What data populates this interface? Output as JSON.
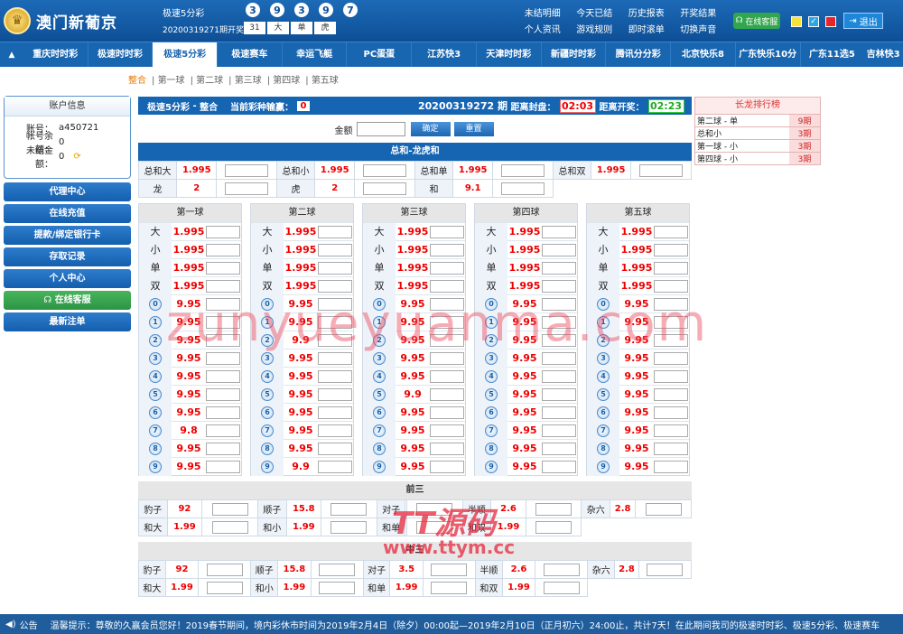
{
  "brand": "澳门新葡京",
  "header": {
    "game": "极速5分彩",
    "draw_label": "20200319271期开奖",
    "balls": [
      "3",
      "9",
      "3",
      "9",
      "7"
    ],
    "sum": [
      "31",
      "大",
      "单",
      "虎"
    ]
  },
  "toplinks": {
    "row1": [
      "未结明细",
      "今天已结",
      "历史报表",
      "开奖结果"
    ],
    "row2": [
      "个人资讯",
      "游戏规则",
      "即时滚单",
      "切换声音"
    ]
  },
  "service_btn": "在线客服",
  "logout": "退出",
  "colors": {
    "nav": "#1865b0",
    "odds": "#e00",
    "green": "#31a64c"
  },
  "nav": [
    "重庆时时彩",
    "极速时时彩",
    "极速5分彩",
    "极速赛车",
    "幸运飞艇",
    "PC蛋蛋",
    "江苏快3",
    "天津时时彩",
    "新疆时时彩",
    "腾讯分分彩",
    "北京快乐8",
    "广东快乐10分",
    "广东11选5",
    "吉林快3"
  ],
  "subnav": [
    "整合",
    "第一球",
    "第二球",
    "第三球",
    "第四球",
    "第五球"
  ],
  "account": {
    "title": "账户信息",
    "rows": [
      [
        "账号：",
        "a450721"
      ],
      [
        "帐号余额：",
        "0"
      ],
      [
        "未结金额：",
        "0"
      ]
    ]
  },
  "side_buttons": [
    "代理中心",
    "在线充值",
    "提款/绑定银行卡",
    "存取记录",
    "个人中心",
    "在线客服",
    "最新注单"
  ],
  "bar": {
    "game": "极速5分彩",
    "mode": "整合",
    "unsettled_label": "当前彩种输赢：",
    "unsettled": "0",
    "draw": "20200319272 期",
    "close_label": "距离封盘：",
    "close": "02:03",
    "open_label": "距离开奖：",
    "open": "02:23"
  },
  "amount": {
    "label": "金额",
    "ok": "确定",
    "reset": "重置"
  },
  "total": {
    "title": "总和-龙虎和",
    "row1": [
      [
        "总和大",
        "1.995"
      ],
      [
        "总和小",
        "1.995"
      ],
      [
        "总和单",
        "1.995"
      ],
      [
        "总和双",
        "1.995"
      ]
    ],
    "row2": [
      [
        "龙",
        "2"
      ],
      [
        "虎",
        "2"
      ],
      [
        "和",
        "9.1"
      ]
    ]
  },
  "balls": [
    {
      "title": "第一球",
      "big": "1.995",
      "small": "1.995",
      "odd": "1.995",
      "even": "1.995",
      "nums": [
        "9.95",
        "9.95",
        "9.95",
        "9.95",
        "9.95",
        "9.95",
        "9.95",
        "9.8",
        "9.95",
        "9.95"
      ]
    },
    {
      "title": "第二球",
      "big": "1.995",
      "small": "1.995",
      "odd": "1.995",
      "even": "1.995",
      "nums": [
        "9.95",
        "9.95",
        "9.9",
        "9.95",
        "9.95",
        "9.95",
        "9.95",
        "9.95",
        "9.95",
        "9.9"
      ]
    },
    {
      "title": "第三球",
      "big": "1.995",
      "small": "1.995",
      "odd": "1.995",
      "even": "1.995",
      "nums": [
        "9.95",
        "9.95",
        "9.95",
        "9.95",
        "9.95",
        "9.9",
        "9.95",
        "9.95",
        "9.95",
        "9.95"
      ]
    },
    {
      "title": "第四球",
      "big": "1.995",
      "small": "1.995",
      "odd": "1.995",
      "even": "1.995",
      "nums": [
        "9.95",
        "9.95",
        "9.95",
        "9.95",
        "9.95",
        "9.95",
        "9.95",
        "9.95",
        "9.95",
        "9.95"
      ]
    },
    {
      "title": "第五球",
      "big": "1.995",
      "small": "1.995",
      "odd": "1.995",
      "even": "1.995",
      "nums": [
        "9.95",
        "9.95",
        "9.95",
        "9.95",
        "9.95",
        "9.95",
        "9.95",
        "9.95",
        "9.95",
        "9.95"
      ]
    }
  ],
  "labels": {
    "big": "大",
    "small": "小",
    "odd": "单",
    "even": "双"
  },
  "front3": {
    "title": "前三",
    "row1": [
      [
        "豹子",
        "92"
      ],
      [
        "顺子",
        "15.8"
      ],
      [
        "对子",
        ""
      ],
      [
        "半顺",
        "2.6"
      ],
      [
        "杂六",
        "2.8"
      ]
    ],
    "row2": [
      [
        "和大",
        "1.99"
      ],
      [
        "和小",
        "1.99"
      ],
      [
        "和单",
        ""
      ],
      [
        "和双",
        "1.99"
      ]
    ]
  },
  "mid3": {
    "title": "中三",
    "row1": [
      [
        "豹子",
        "92"
      ],
      [
        "顺子",
        "15.8"
      ],
      [
        "对子",
        "3.5"
      ],
      [
        "半顺",
        "2.6"
      ],
      [
        "杂六",
        "2.8"
      ]
    ],
    "row2": [
      [
        "和大",
        "1.99"
      ],
      [
        "和小",
        "1.99"
      ],
      [
        "和单",
        "1.99"
      ],
      [
        "和双",
        "1.99"
      ]
    ]
  },
  "longdragon": {
    "title": "长龙排行榜",
    "rows": [
      [
        "第二球 - 单",
        "9期"
      ],
      [
        "总和小",
        "3期"
      ],
      [
        "第一球 - 小",
        "3期"
      ],
      [
        "第四球 - 小",
        "3期"
      ]
    ]
  },
  "notice": {
    "label": "公告",
    "text": "温馨提示：尊敬的久赢会员您好！2019春节期间，境内彩休市时间为2019年2月4日（除夕）00:00起—2019年2月10日（正月初六）24:00止，共计7天！在此期间我司的极速时时彩、极速5分彩、极速赛车"
  },
  "watermarks": [
    "zunyueyuanma.com",
    "TT源码",
    "www.ttym.cc"
  ]
}
